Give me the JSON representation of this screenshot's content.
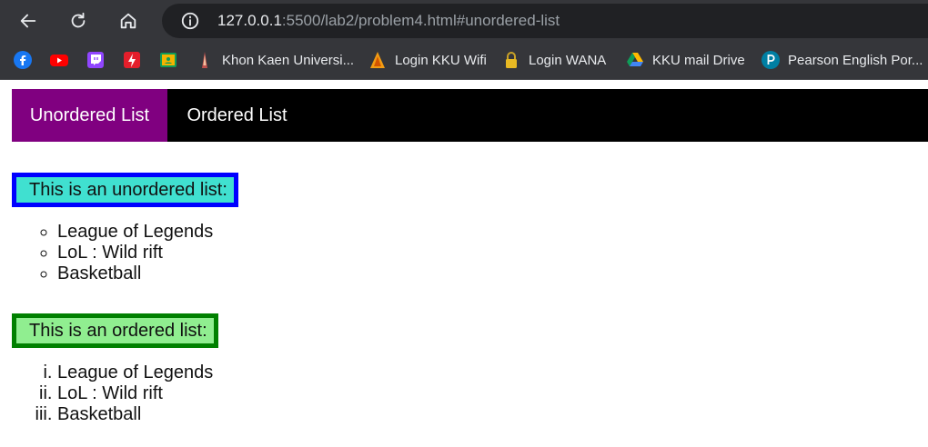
{
  "browser": {
    "url_host": "127.0.0.1",
    "url_rest": ":5500/lab2/problem4.html#unordered-list",
    "bookmarks": [
      {
        "label": "",
        "icon": "facebook-icon"
      },
      {
        "label": "",
        "icon": "youtube-icon"
      },
      {
        "label": "",
        "icon": "twitch-icon"
      },
      {
        "label": "",
        "icon": "flash-icon"
      },
      {
        "label": "",
        "icon": "classroom-icon"
      },
      {
        "label": "Khon Kaen Universi...",
        "icon": "kku-icon"
      },
      {
        "label": "Login KKU Wifi",
        "icon": "wifi-login-icon"
      },
      {
        "label": "Login WANA",
        "icon": "lock-icon"
      },
      {
        "label": "KKU mail Drive",
        "icon": "google-drive-icon"
      },
      {
        "label": "Pearson English Por...",
        "icon": "pearson-icon"
      }
    ]
  },
  "nav": {
    "tabs": [
      {
        "label": "Unordered List",
        "active": true
      },
      {
        "label": "Ordered List",
        "active": false
      }
    ]
  },
  "unordered": {
    "heading": "This is an unordered list:",
    "items": [
      "League of Legends",
      "LoL : Wild rift",
      "Basketball"
    ]
  },
  "ordered": {
    "heading": "This is an ordered list:",
    "items": [
      "League of Legends",
      "LoL : Wild rift",
      "Basketball"
    ]
  },
  "colors": {
    "nav_bg": "#000000",
    "active_tab": "#800080",
    "unordered_border": "#0000ff",
    "unordered_fill": "#40e0d0",
    "ordered_border": "#008000",
    "ordered_fill": "#90ee90"
  }
}
